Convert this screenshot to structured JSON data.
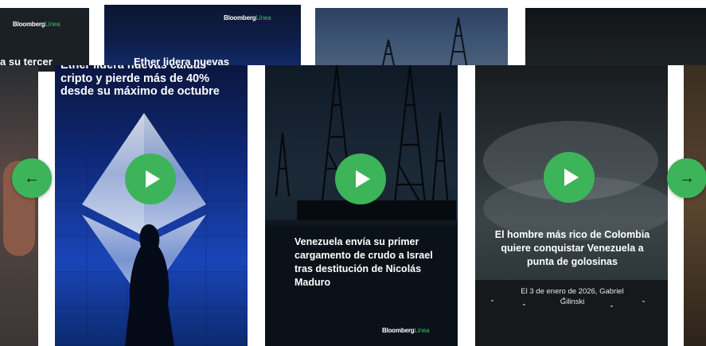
{
  "carousel": {
    "prev_arrow": "←",
    "next_arrow": "→",
    "play_symbol": ""
  },
  "back_row": {
    "card1": {
      "brand": "Bloomberg",
      "brand_accent": "Línea",
      "partial_text": "a su tercer"
    },
    "card2": {
      "brand": "Bloomberg",
      "brand_accent": "Línea",
      "headline": "Ether lidera nuevas"
    }
  },
  "stories": [
    {
      "headline": "Ether lidera nuevas caídas cripto y pierde más de 40% desde su máximo de octubre"
    },
    {
      "headline": "Venezuela envía su primer cargamento de crudo a Israel tras destitución de Nicolás Maduro",
      "brand": "Bloomberg",
      "brand_accent": "Línea"
    },
    {
      "headline": "El hombre más rico de Colombia quiere conquistar Venezuela a punta de golosinas",
      "caption": "El 3 de enero de 2026, Gabriel Gilinski"
    }
  ],
  "colors": {
    "accent_green": "#3db35a",
    "text_white": "#ffffff"
  }
}
